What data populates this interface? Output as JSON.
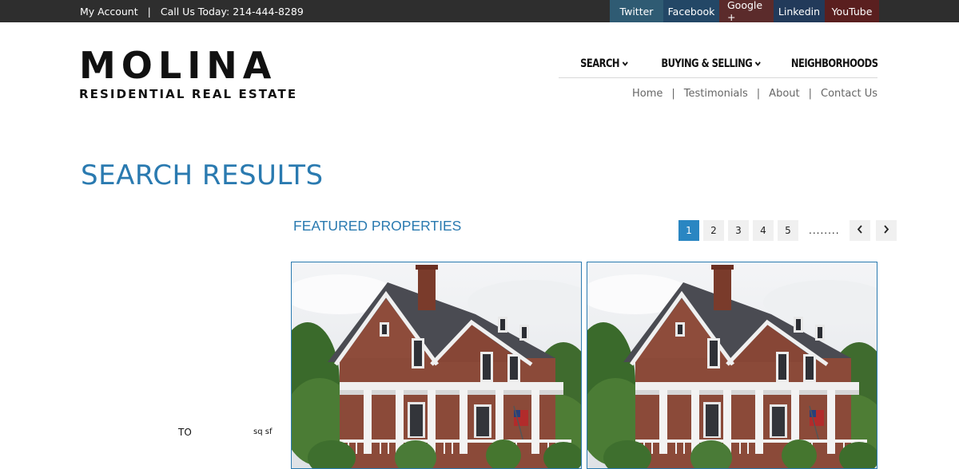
{
  "topbar": {
    "my_account": "My Account",
    "separator": "|",
    "call_us": "Call Us Today: 214-444-8289"
  },
  "social": [
    {
      "label": "Twitter",
      "color": "#2f5b73"
    },
    {
      "label": "Facebook",
      "color": "#234766"
    },
    {
      "label": "Google +",
      "color": "#5b2b2b"
    },
    {
      "label": "Linkedin",
      "color": "#223a5a"
    },
    {
      "label": "YouTube",
      "color": "#5a1f1f"
    }
  ],
  "logo": {
    "name": "MOLINA",
    "tagline": "RESIDENTIAL REAL ESTATE"
  },
  "mainnav": {
    "search": "SEARCH",
    "buying_selling": "BUYING & SELLING",
    "neighborhoods": "NEIGHBORHOODS"
  },
  "subnav": {
    "home": "Home",
    "testimonials": "Testimonials",
    "about": "About",
    "contact": "Contact Us",
    "separator": "|"
  },
  "page": {
    "title": "SEARCH RESULTS",
    "featured_title": "FEATURED PROPERTIES"
  },
  "pagination": {
    "pages": [
      "1",
      "2",
      "3",
      "4",
      "5"
    ],
    "active": "1",
    "ellipsis": "........",
    "prev": "‹",
    "next": "›"
  },
  "filters": {
    "to_label": "TO",
    "sqsf_label": "sq sf"
  },
  "colors": {
    "accent": "#2a7ab0",
    "topbar": "#2e2e2e",
    "pager_active": "#2a86c2"
  }
}
